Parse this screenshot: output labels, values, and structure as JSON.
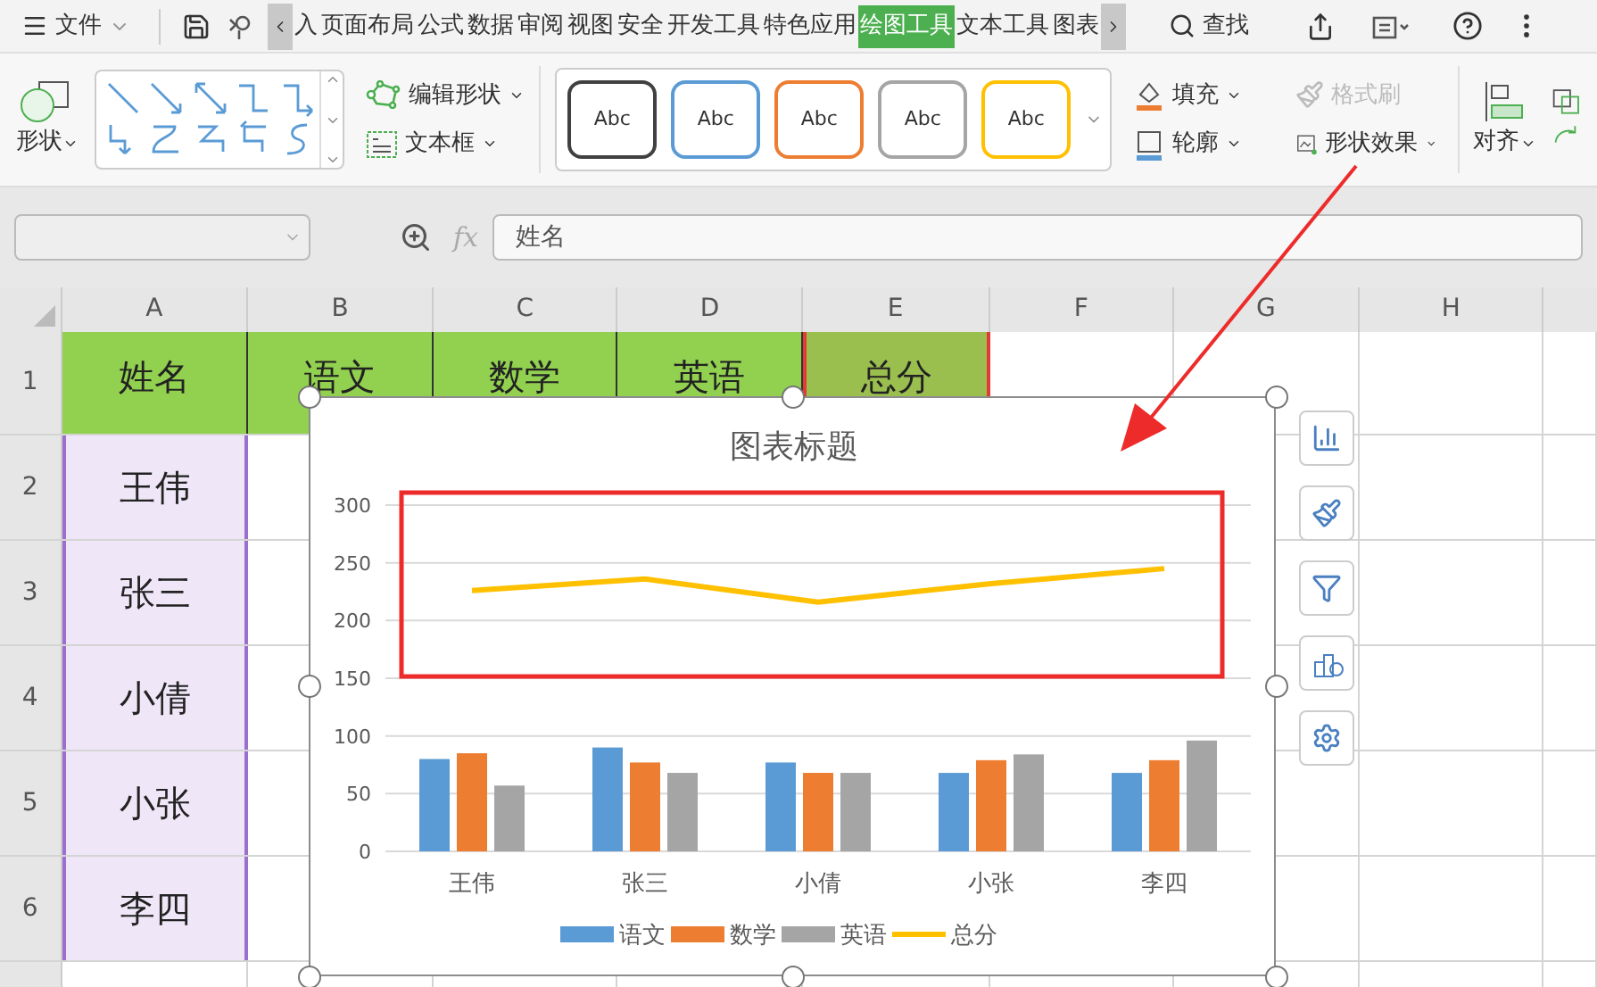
{
  "menu_bar": {
    "file_menu": "文件",
    "tabs": [
      {
        "label": "入",
        "selected": false
      },
      {
        "label": "页面布局",
        "selected": false
      },
      {
        "label": "公式",
        "selected": false
      },
      {
        "label": "数据",
        "selected": false
      },
      {
        "label": "审阅",
        "selected": false
      },
      {
        "label": "视图",
        "selected": false
      },
      {
        "label": "安全",
        "selected": false
      },
      {
        "label": "开发工具",
        "selected": false
      },
      {
        "label": "特色应用",
        "selected": false
      },
      {
        "label": "绘图工具",
        "selected": true
      },
      {
        "label": "文本工具",
        "selected": false
      },
      {
        "label": "图表",
        "selected": false
      }
    ],
    "search": "查找"
  },
  "ribbon": {
    "shape_button": "形状",
    "edit_shape": "编辑形状",
    "text_box": "文本框",
    "style_samples": [
      {
        "label": "Abc",
        "color": "#404040",
        "selected": false
      },
      {
        "label": "Abc",
        "color": "#5b9bd5",
        "selected": false
      },
      {
        "label": "Abc",
        "color": "#ed7d31",
        "selected": false
      },
      {
        "label": "Abc",
        "color": "#a5a5a5",
        "selected": false
      },
      {
        "label": "Abc",
        "color": "#ffc000",
        "selected": false
      }
    ],
    "fill": "填充",
    "format_painter": {
      "label": "格式刷",
      "disabled": true
    },
    "outline": "轮廓",
    "shape_effects": "形状效果",
    "align": "对齐"
  },
  "formula_bar": {
    "fx": "fx",
    "formula": "姓名"
  },
  "sheet": {
    "columns": [
      "A",
      "B",
      "C",
      "D",
      "E",
      "F",
      "G",
      "H"
    ],
    "rows": [
      {
        "number": "1",
        "kind": "header",
        "cells": [
          {
            "text": "姓名",
            "selected": false
          },
          {
            "text": "语文",
            "selected": false
          },
          {
            "text": "数学",
            "selected": false
          },
          {
            "text": "英语",
            "selected": false
          },
          {
            "text": "总分",
            "selected": true
          }
        ]
      },
      {
        "number": "2",
        "kind": "data",
        "cells": [
          {
            "text": "王伟",
            "selected": true
          }
        ]
      },
      {
        "number": "3",
        "kind": "data",
        "cells": [
          {
            "text": "张三",
            "selected": true
          }
        ]
      },
      {
        "number": "4",
        "kind": "data",
        "cells": [
          {
            "text": "小倩",
            "selected": true
          }
        ]
      },
      {
        "number": "5",
        "kind": "data",
        "cells": [
          {
            "text": "小张",
            "selected": true
          }
        ]
      },
      {
        "number": "6",
        "kind": "data",
        "cells": [
          {
            "text": "李四",
            "selected": true
          }
        ]
      }
    ]
  },
  "chart": {
    "chart_data": {
      "type": "bar",
      "title": "图表标题",
      "categories": [
        "王伟",
        "张三",
        "小倩",
        "小张",
        "李四"
      ],
      "series": [
        {
          "name": "语文",
          "color": "#5b9bd5",
          "values": [
            80,
            90,
            77,
            68,
            68
          ]
        },
        {
          "name": "数学",
          "color": "#ed7d31",
          "values": [
            85,
            77,
            68,
            79,
            79
          ]
        },
        {
          "name": "英语",
          "color": "#a5a5a5",
          "values": [
            57,
            68,
            68,
            84,
            96
          ]
        },
        {
          "name": "总分",
          "color": "#ffc000",
          "type": "line",
          "values": [
            226,
            236,
            216,
            232,
            245
          ]
        }
      ],
      "grid": true,
      "legend": true,
      "ylim": [
        0,
        300
      ],
      "yticks": [
        0,
        50,
        100,
        150,
        200,
        250,
        300
      ]
    }
  }
}
